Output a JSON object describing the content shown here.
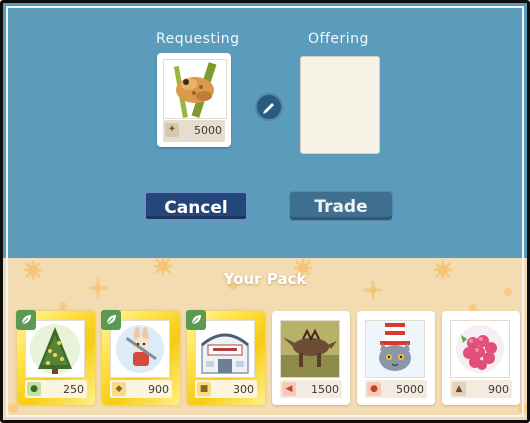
{
  "trade": {
    "requesting_label": "Requesting",
    "offering_label": "Offering",
    "requested_card": {
      "name": "toad-card",
      "value": "5000",
      "icon": "acorn-icon"
    },
    "swap_icon": "pencil-icon",
    "cancel_label": "Cancel",
    "trade_label": "Trade"
  },
  "pack": {
    "title": "Your Pack",
    "cards": [
      {
        "art": "christmas-tree",
        "value": "250",
        "frame": "gold",
        "badge": "leaf-icon",
        "footer_icon": "caterpillar-icon"
      },
      {
        "art": "rabbit-character",
        "value": "900",
        "frame": "gold",
        "badge": "leaf-icon",
        "footer_icon": "mask-icon"
      },
      {
        "art": "house-sign",
        "value": "300",
        "frame": "gold",
        "badge": "leaf-icon",
        "footer_icon": "bear-icon"
      },
      {
        "art": "dinosaur",
        "value": "1500",
        "frame": "plain",
        "footer_icon": "lizard-icon"
      },
      {
        "art": "cat-in-hat",
        "value": "5000",
        "frame": "plain",
        "footer_icon": "bug-icon"
      },
      {
        "art": "raspberry",
        "value": "900",
        "frame": "plain",
        "footer_icon": "owl-icon"
      }
    ]
  },
  "colors": {
    "top_panel": "#5b9cbd",
    "pack_panel": "#f3dcb2",
    "cancel_button": "#24467a",
    "trade_button": "#3e6f8f",
    "gold_frame": "#f6cc12"
  }
}
